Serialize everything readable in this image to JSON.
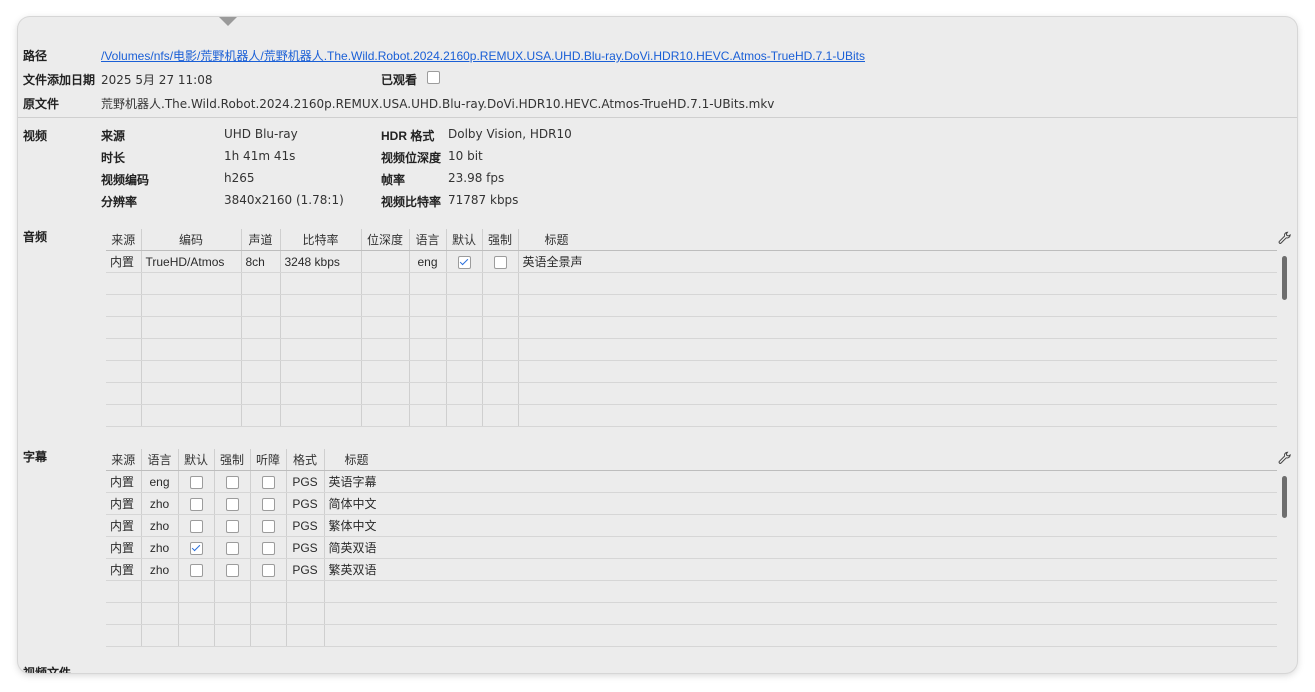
{
  "info": {
    "path_label": "路径",
    "path_value": "/Volumes/nfs/电影/荒野机器人/荒野机器人.The.Wild.Robot.2024.2160p.REMUX.USA.UHD.Blu-ray.DoVi.HDR10.HEVC.Atmos-TrueHD.7.1-UBits",
    "added_label": "文件添加日期",
    "added_value": "2025 5月 27 11:08",
    "watched_label": "已观看",
    "original_label": "原文件",
    "original_value": "荒野机器人.The.Wild.Robot.2024.2160p.REMUX.USA.UHD.Blu-ray.DoVi.HDR10.HEVC.Atmos-TrueHD.7.1-UBits.mkv"
  },
  "video": {
    "section_label": "视频",
    "source_label": "来源",
    "source_value": "UHD Blu-ray",
    "duration_label": "时长",
    "duration_value": "1h 41m 41s",
    "codec_label": "视频编码",
    "codec_value": "h265",
    "resolution_label": "分辨率",
    "resolution_value": "3840x2160 (1.78:1)",
    "hdr_label": "HDR 格式",
    "hdr_value": "Dolby Vision, HDR10",
    "depth_label": "视频位深度",
    "depth_value": "10 bit",
    "fps_label": "帧率",
    "fps_value": "23.98 fps",
    "bitrate_label": "视频比特率",
    "bitrate_value": "71787 kbps"
  },
  "audio": {
    "section_label": "音频",
    "columns": [
      "来源",
      "编码",
      "声道",
      "比特率",
      "位深度",
      "语言",
      "默认",
      "强制",
      "标题"
    ],
    "rows": [
      {
        "source": "内置",
        "codec": "TrueHD/Atmos",
        "channels": "8ch",
        "bitrate": "3248 kbps",
        "depth": "",
        "lang": "eng",
        "default": true,
        "forced": false,
        "title": "英语全景声"
      }
    ]
  },
  "subtitles": {
    "section_label": "字幕",
    "columns": [
      "来源",
      "语言",
      "默认",
      "强制",
      "听障",
      "格式",
      "标题"
    ],
    "rows": [
      {
        "source": "内置",
        "lang": "eng",
        "default": false,
        "forced": false,
        "sdh": false,
        "format": "PGS",
        "title": "英语字幕"
      },
      {
        "source": "内置",
        "lang": "zho",
        "default": false,
        "forced": false,
        "sdh": false,
        "format": "PGS",
        "title": "简体中文"
      },
      {
        "source": "内置",
        "lang": "zho",
        "default": false,
        "forced": false,
        "sdh": false,
        "format": "PGS",
        "title": "繁体中文"
      },
      {
        "source": "内置",
        "lang": "zho",
        "default": true,
        "forced": false,
        "sdh": false,
        "format": "PGS",
        "title": "简英双语"
      },
      {
        "source": "内置",
        "lang": "zho",
        "default": false,
        "forced": false,
        "sdh": false,
        "format": "PGS",
        "title": "繁英双语"
      }
    ]
  },
  "video_files": {
    "section_label": "视频文件"
  }
}
